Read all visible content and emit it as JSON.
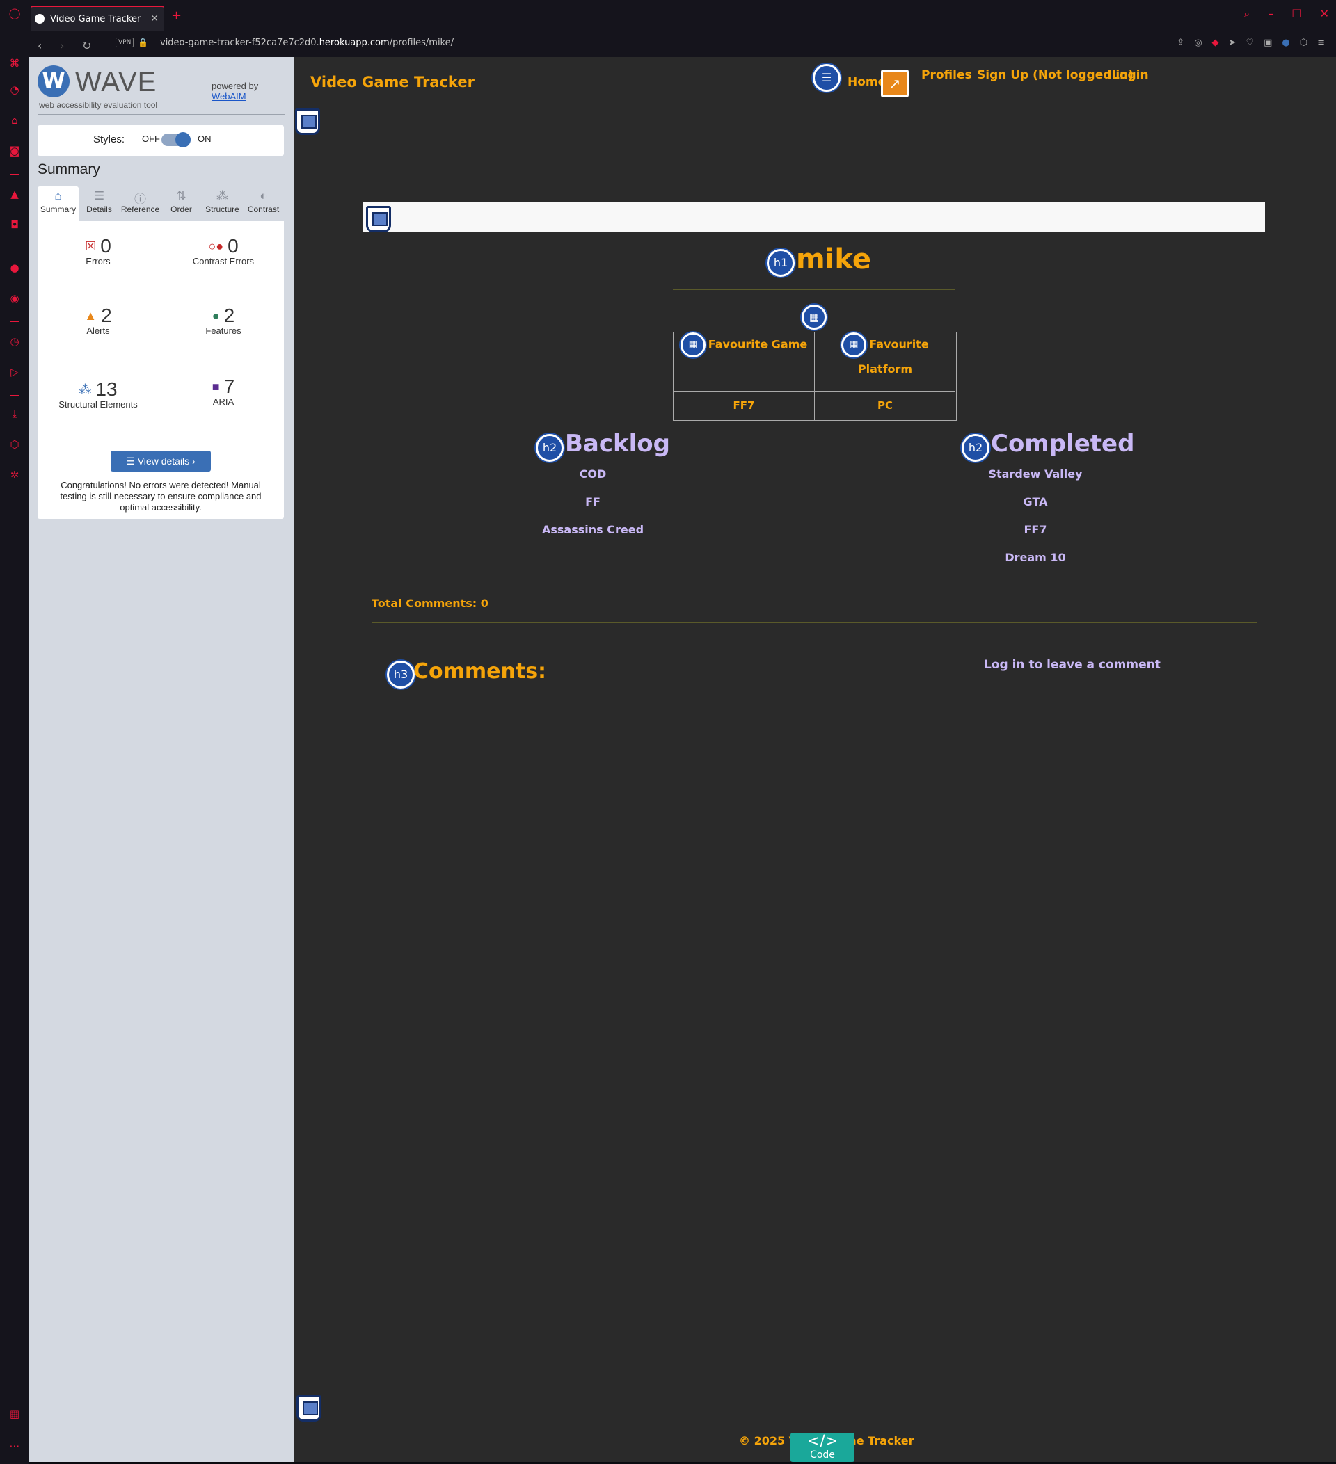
{
  "browser": {
    "tab_title": "Video Game Tracker",
    "tab_close": "✕",
    "new_tab": "+",
    "vpn": "VPN",
    "url_prefix": "video-game-tracker-f52ca7e7c2d0.",
    "url_domain": "herokuapp.com",
    "url_path": "/profiles/mike/"
  },
  "wave": {
    "logo_mark": "W",
    "logo_text": "WAVE",
    "tagline": "web accessibility evaluation tool",
    "powered_by": "powered by",
    "webaim": "WebAIM",
    "styles_label": "Styles:",
    "styles_off": "OFF",
    "styles_on": "ON",
    "summary_title": "Summary",
    "tabs": [
      "Summary",
      "Details",
      "Reference",
      "Order",
      "Structure",
      "Contrast"
    ],
    "stats": {
      "errors": {
        "value": "0",
        "label": "Errors"
      },
      "contrast_errors": {
        "value": "0",
        "label": "Contrast Errors"
      },
      "alerts": {
        "value": "2",
        "label": "Alerts"
      },
      "features": {
        "value": "2",
        "label": "Features"
      },
      "structural": {
        "value": "13",
        "label": "Structural Elements"
      },
      "aria": {
        "value": "7",
        "label": "ARIA"
      }
    },
    "view_details": "View details ›",
    "congrats": "Congratulations! No errors were detected! Manual testing is still necessary to ensure compliance and optimal accessibility."
  },
  "site": {
    "brand": "Video Game Tracker",
    "nav": {
      "home": "Home",
      "profiles": "Profiles",
      "signup": "Sign Up (Not logged in)",
      "login": "Login"
    },
    "username": "mike",
    "table": {
      "headers": [
        "Favourite Game",
        "Favourite Platform"
      ],
      "values": [
        "FF7",
        "PC"
      ]
    },
    "backlog": {
      "title": "Backlog",
      "items": [
        "COD",
        "FF",
        "Assassins Creed"
      ]
    },
    "completed": {
      "title": "Completed",
      "items": [
        "Stardew Valley",
        "GTA",
        "FF7",
        "Dream 10"
      ]
    },
    "total_comments": "Total Comments: 0",
    "comments_title": "Comments:",
    "login_comment": "Log in to leave a comment",
    "footer": "© 2025 Video Game Tracker",
    "code_button": "Code",
    "badges": {
      "h1": "h1",
      "h2": "h2",
      "h3": "h3"
    }
  }
}
